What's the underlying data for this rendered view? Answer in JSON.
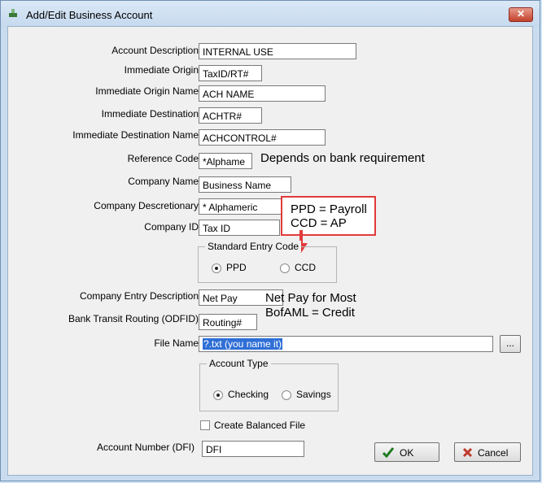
{
  "window": {
    "title": "Add/Edit Business Account",
    "close_label": "✕"
  },
  "fields": [
    {
      "label": "Account Description",
      "value": "INTERNAL USE"
    },
    {
      "label": "Immediate Origin",
      "value": "TaxID/RT#"
    },
    {
      "label": "Immediate Origin Name",
      "value": "ACH NAME"
    },
    {
      "label": "Immediate Destination",
      "value": "ACHTR#"
    },
    {
      "label": "Immediate Destination Name",
      "value": "ACHCONTROL#"
    },
    {
      "label": "Reference Code",
      "value": "*Alphame"
    },
    {
      "label": "Company Name",
      "value": "Business Name"
    },
    {
      "label": "Company Descretionary",
      "value": "* Alphameric"
    },
    {
      "label": "Company ID",
      "value": "Tax ID"
    },
    {
      "label": "Company Entry Description",
      "value": "Net Pay"
    },
    {
      "label": "Bank Transit Routing (ODFID)",
      "value": "Routing#"
    },
    {
      "label": "File Name",
      "value": "?.txt (you name it)"
    },
    {
      "label": "Account Number (DFI)",
      "value": "DFI"
    }
  ],
  "standard_entry_code": {
    "title": "Standard Entry Code",
    "options": [
      "PPD",
      "CCD"
    ],
    "selected": "PPD"
  },
  "account_type": {
    "title": "Account Type",
    "options": [
      "Checking",
      "Savings"
    ],
    "selected": "Checking"
  },
  "create_balanced_file": {
    "label": "Create Balanced File",
    "checked": false
  },
  "browse_label": "...",
  "buttons": {
    "ok": "OK",
    "cancel": "Cancel"
  },
  "annotations": {
    "reference_note": "Depends on bank requirement",
    "code_box_line1": "PPD = Payroll",
    "code_box_line2": "CCD = AP",
    "entry_note_line1": "Net Pay for Most",
    "entry_note_line2": "BofAML = Credit"
  },
  "colors": {
    "annotation_red": "#e23b3b",
    "selection_blue": "#2f6fd6",
    "titlebar": "#c9dcef"
  }
}
